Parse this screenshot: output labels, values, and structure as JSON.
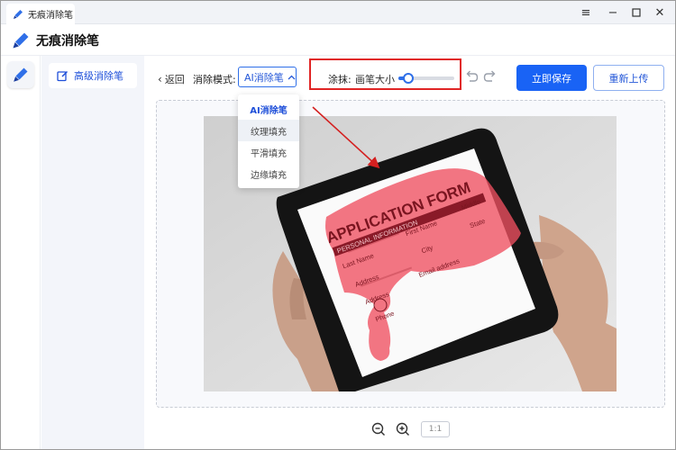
{
  "window": {
    "tab_title": "无痕消除笔",
    "minimize_icon": "minimize-icon",
    "restore_icon": "restore-icon",
    "close_icon": "close-icon",
    "menu_icon": "menu-icon"
  },
  "header": {
    "title": "无痕消除笔",
    "logo_icon": "brush-icon"
  },
  "sidenav": {
    "items": [
      {
        "label": "高级消除笔",
        "icon": "edit-icon"
      }
    ]
  },
  "toolbar": {
    "back_label": "返回",
    "mode_label": "消除模式:",
    "mode_selected": "AI消除笔",
    "smear_label": "涂抹:",
    "brush_size_label": "画笔大小",
    "brush_size_fraction": 0.18,
    "save_label": "立即保存",
    "reupload_label": "重新上传"
  },
  "mode_options": [
    "AI消除笔",
    "纹理填充",
    "平滑填充",
    "边缘填充"
  ],
  "zoom": {
    "ratio_label": "1:1"
  },
  "photo": {
    "form_title": "APPLICATION FORM",
    "section_title": "PERSONAL INFORMATION",
    "fields": [
      "Last Name",
      "First Name",
      "Middle",
      "Address",
      "City",
      "State",
      "Address",
      "Email address",
      "Phone"
    ]
  },
  "colors": {
    "accent": "#1963f5",
    "highlight_box": "#e02525",
    "brush_overlay": "#f05060"
  }
}
